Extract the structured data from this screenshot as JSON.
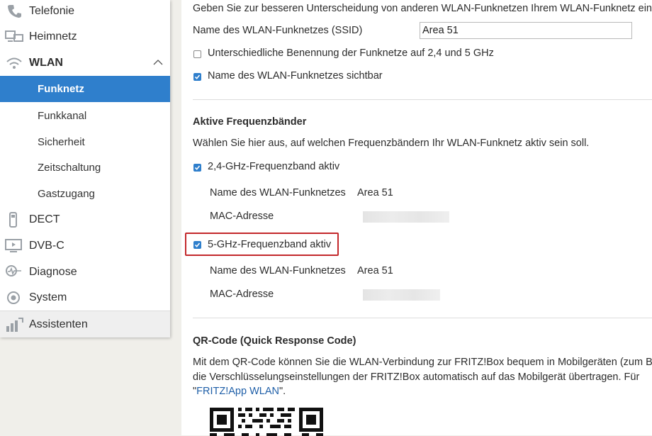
{
  "sidebar": {
    "items": [
      {
        "label": "Telefonie",
        "icon": "phone-icon"
      },
      {
        "label": "Heimnetz",
        "icon": "network-icon"
      },
      {
        "label": "WLAN",
        "icon": "wifi-icon"
      },
      {
        "label": "DECT",
        "icon": "dect-phone-icon"
      },
      {
        "label": "DVB-C",
        "icon": "tv-icon"
      },
      {
        "label": "Diagnose",
        "icon": "diagnose-icon"
      },
      {
        "label": "System",
        "icon": "system-icon"
      },
      {
        "label": "Assistenten",
        "icon": "assistant-icon"
      }
    ],
    "wlan_sub": [
      {
        "label": "Funknetz",
        "active": true
      },
      {
        "label": "Funkkanal",
        "active": false
      },
      {
        "label": "Sicherheit",
        "active": false
      },
      {
        "label": "Zeitschaltung",
        "active": false
      },
      {
        "label": "Gastzugang",
        "active": false
      }
    ]
  },
  "main": {
    "intro": "Geben Sie zur besseren Unterscheidung von anderen WLAN-Funknetzen Ihrem WLAN-Funknetz ein",
    "ssid_label": "Name des WLAN-Funknetzes (SSID)",
    "ssid_value": "Area 51",
    "separate_names_label": "Unterschiedliche Benennung der Funknetze auf 2,4 und 5 GHz",
    "separate_names_checked": false,
    "visible_label": "Name des WLAN-Funknetzes sichtbar",
    "visible_checked": true,
    "bands_heading": "Aktive Frequenzbänder",
    "bands_desc": "Wählen Sie hier aus, auf welchen Frequenzbändern Ihr WLAN-Funknetz aktiv sein soll.",
    "band24": {
      "label": "2,4-GHz-Frequenzband aktiv",
      "checked": true,
      "name_label": "Name des WLAN-Funknetzes",
      "name_value": "Area 51",
      "mac_label": "MAC-Adresse"
    },
    "band5": {
      "label": "5-GHz-Frequenzband aktiv",
      "checked": true,
      "name_label": "Name des WLAN-Funknetzes",
      "name_value": "Area 51",
      "mac_label": "MAC-Adresse"
    },
    "qr_heading": "QR-Code (Quick Response Code)",
    "qr_text_1": "Mit dem QR-Code können Sie die WLAN-Verbindung zur FRITZ!Box bequem in Mobilgeräten (zum B",
    "qr_text_2": "die Verschlüsselungseinstellungen der FRITZ!Box automatisch auf das Mobilgerät übertragen. Für",
    "qr_link_open": "\"",
    "qr_link": "FRITZ!App WLAN",
    "qr_link_close": "\"."
  },
  "colors": {
    "accent": "#2f7fcc",
    "highlight": "#c3282b",
    "background": "#f0efea"
  }
}
